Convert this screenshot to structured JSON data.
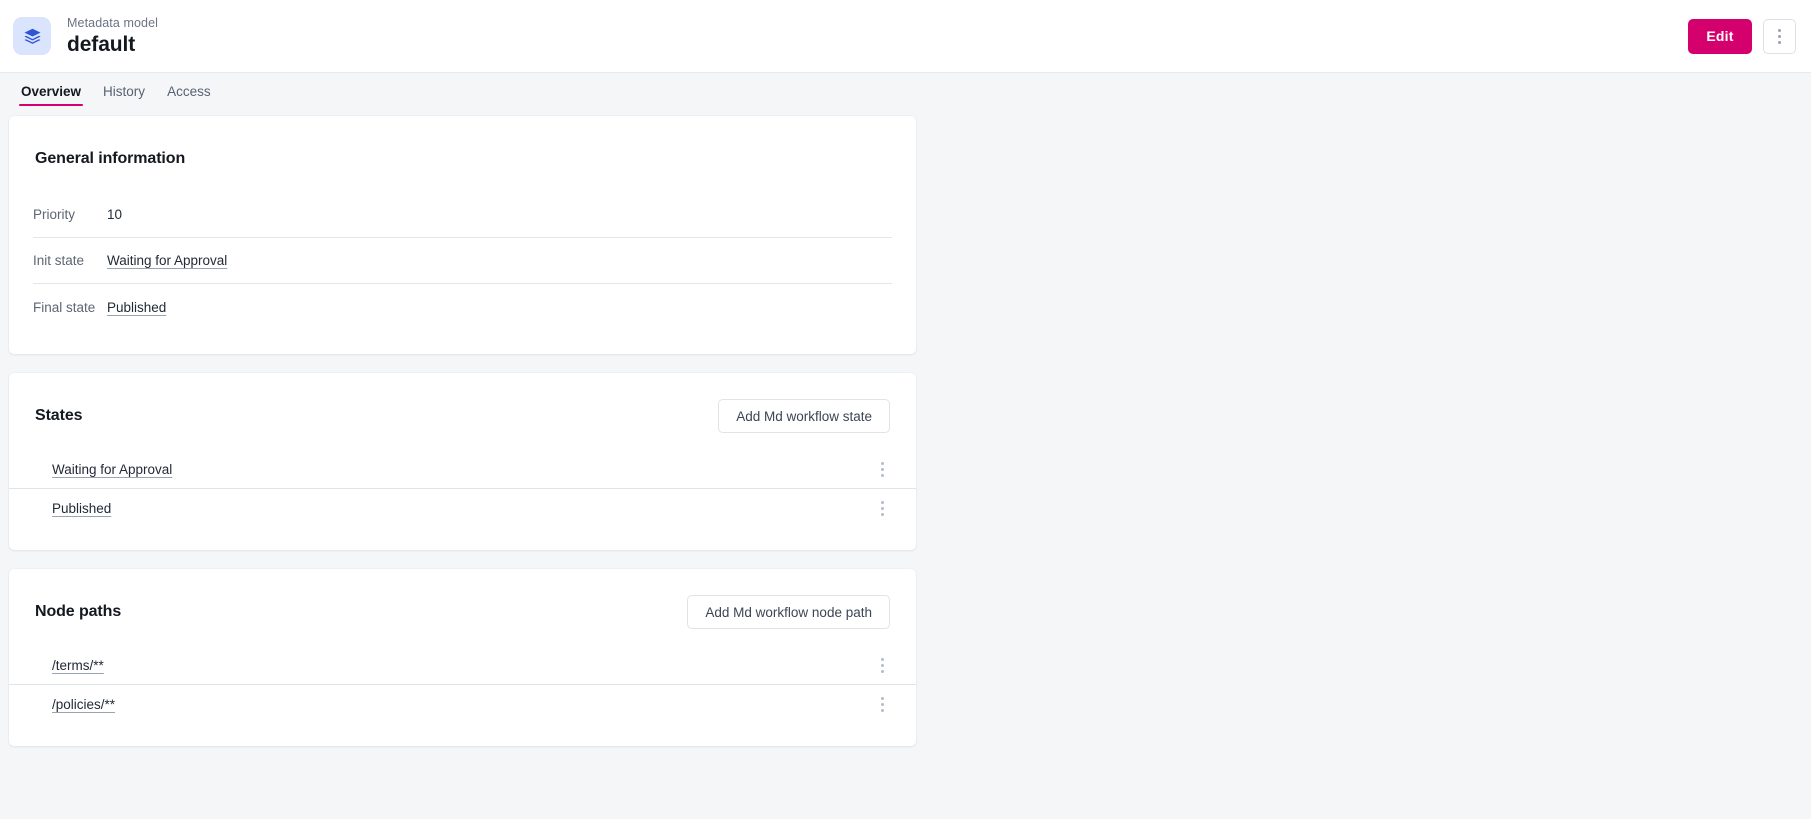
{
  "header": {
    "icon": "layers-icon",
    "eyebrow": "Metadata model",
    "title": "default",
    "edit_label": "Edit",
    "kebab_label": "more-options",
    "accent_color": "#d4006e",
    "icon_bg_color": "#dbe4fd",
    "icon_color": "#3056d3"
  },
  "tabs": [
    {
      "label": "Overview",
      "active": true
    },
    {
      "label": "History",
      "active": false
    },
    {
      "label": "Access",
      "active": false
    }
  ],
  "general": {
    "title": "General information",
    "rows": [
      {
        "label": "Priority",
        "value": "10",
        "link": false
      },
      {
        "label": "Init state",
        "value": "Waiting for Approval",
        "link": true
      },
      {
        "label": "Final state",
        "value": "Published",
        "link": true
      }
    ]
  },
  "states": {
    "title": "States",
    "add_button": "Add Md workflow state",
    "items": [
      {
        "label": "Waiting for Approval"
      },
      {
        "label": "Published"
      }
    ]
  },
  "node_paths": {
    "title": "Node paths",
    "add_button": "Add Md workflow node path",
    "items": [
      {
        "label": "/terms/**"
      },
      {
        "label": "/policies/**"
      }
    ]
  }
}
